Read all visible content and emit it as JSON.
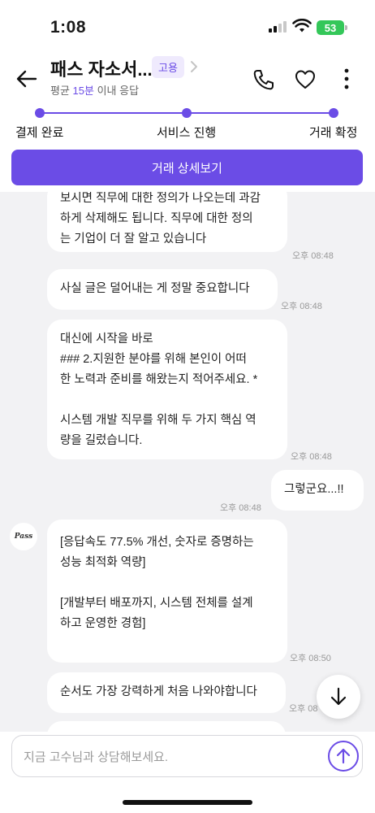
{
  "status_bar": {
    "time": "1:08",
    "battery": "53"
  },
  "header": {
    "title": "패스 자소서...",
    "tag": "고용",
    "subtitle_prefix": "평균 ",
    "subtitle_highlight": "15분",
    "subtitle_suffix": " 이내 응답"
  },
  "progress": {
    "steps": [
      {
        "label": "결제 완료"
      },
      {
        "label": "서비스 진행"
      },
      {
        "label": "거래 확정"
      }
    ]
  },
  "detail_button": "거래 상세보기",
  "messages": [
    {
      "sender": "expert",
      "text": "보시면 직무에 대한 정의가 나오는데 과감\n하게 삭제해도 됩니다. 직무에 대한 정의\n는 기업이 더 잘 알고 있습니다",
      "time": "오후 08:48"
    },
    {
      "sender": "expert",
      "text": "사실 글은 덜어내는 게 정말 중요합니다",
      "time": "오후 08:48"
    },
    {
      "sender": "expert",
      "text": "대신에 시작을 바로\n### 2.지원한 분야를 위해 본인이 어떠\n한 노력과 준비를 해왔는지 적어주세요. *\n\n시스템 개발 직무를 위해 두 가지 핵심 역\n량을 길렀습니다.",
      "time": "오후 08:48"
    },
    {
      "sender": "me",
      "text": "그렇군요...!!",
      "time": "오후 08:48"
    },
    {
      "sender": "expert",
      "text": "[응답속도 77.5% 개선, 숫자로 증명하는\n성능 최적화 역량]\n\n[개발부터 배포까지, 시스템 전체를 설계\n하고 운영한 경험]",
      "time": "오후 08:50"
    },
    {
      "sender": "expert",
      "text": "순서도 가장 강력하게 처음 나와야합니다",
      "time": "오후 08"
    }
  ],
  "avatar_label": "Pass",
  "input": {
    "placeholder": "지금 고수님과 상담해보세요."
  },
  "colors": {
    "accent": "#6b4ce6",
    "chat_bg": "#f2f2f4",
    "battery": "#34c759"
  }
}
